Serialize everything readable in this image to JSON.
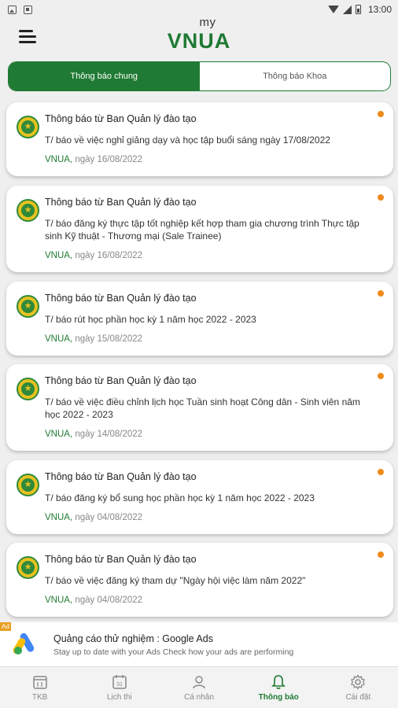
{
  "status_bar": {
    "time": "13:00"
  },
  "header": {
    "logo_small": "my",
    "logo_main": "VNUA"
  },
  "tabs": [
    {
      "label": "Thông báo chung",
      "active": true
    },
    {
      "label": "Thông báo Khoa",
      "active": false
    }
  ],
  "notifications": [
    {
      "title": "Thông báo từ Ban Quản lý đào tạo",
      "description": "T/ báo về việc nghỉ giảng dạy và học tập buổi sáng ngày 17/08/2022",
      "source": "VNUA,",
      "date": "ngày 16/08/2022",
      "unread": true
    },
    {
      "title": "Thông báo từ Ban Quản lý đào tạo",
      "description": "T/ báo đăng ký thực tập tốt nghiệp kết hợp tham gia chương trình Thực tập sinh Kỹ thuật - Thương mại (Sale Trainee)",
      "source": "VNUA,",
      "date": "ngày 16/08/2022",
      "unread": true
    },
    {
      "title": "Thông báo từ Ban Quản lý đào tạo",
      "description": "T/ báo rút học phần học kỳ 1 năm học 2022 - 2023",
      "source": "VNUA,",
      "date": "ngày 15/08/2022",
      "unread": true
    },
    {
      "title": "Thông báo từ Ban Quản lý đào tạo",
      "description": "T/ báo về việc điều chỉnh lịch học Tuần sinh hoạt Công dân - Sinh viên năm học 2022 - 2023",
      "source": "VNUA,",
      "date": "ngày 14/08/2022",
      "unread": true
    },
    {
      "title": "Thông báo từ Ban Quản lý đào tạo",
      "description": "T/ báo đăng ký bổ sung học phần học kỳ 1 năm học 2022 - 2023",
      "source": "VNUA,",
      "date": "ngày 04/08/2022",
      "unread": true
    },
    {
      "title": "Thông báo từ Ban Quản lý đào tạo",
      "description": "T/ báo về việc đăng ký tham dự \"Ngày hội việc làm năm 2022\"",
      "source": "VNUA,",
      "date": "ngày 04/08/2022",
      "unread": true
    }
  ],
  "ad": {
    "badge": "Ad",
    "title": "Quảng cáo thử nghiệm : Google Ads",
    "subtitle": "Stay up to date with your Ads Check how your ads are performing"
  },
  "bottom_nav": [
    {
      "label": "TKB",
      "icon": "timetable-icon",
      "active": false
    },
    {
      "label": "Lịch thi",
      "icon": "calendar-icon",
      "active": false
    },
    {
      "label": "Cá nhân",
      "icon": "person-icon",
      "active": false
    },
    {
      "label": "Thông báo",
      "icon": "bell-icon",
      "active": true
    },
    {
      "label": "Cài đặt",
      "icon": "gear-icon",
      "active": false
    }
  ],
  "colors": {
    "brand_green": "#1f7a33",
    "unread_dot": "#f08a1c",
    "background": "#efefef"
  }
}
